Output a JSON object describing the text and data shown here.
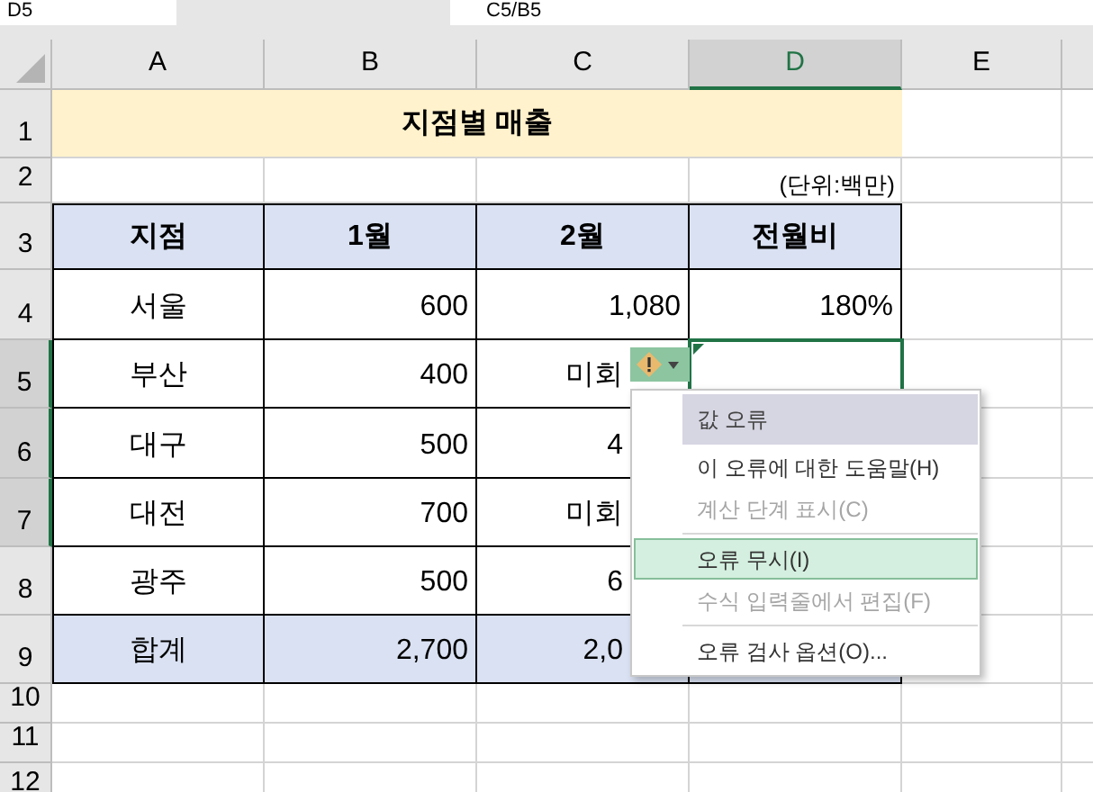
{
  "formula_bar": {
    "name_box": "D5",
    "formula": "C5/B5"
  },
  "column_headers": [
    {
      "label": "A",
      "selected": false
    },
    {
      "label": "B",
      "selected": false
    },
    {
      "label": "C",
      "selected": false
    },
    {
      "label": "D",
      "selected": true
    },
    {
      "label": "E",
      "selected": false
    }
  ],
  "rows": [
    {
      "number": "1",
      "selected": false,
      "kind": "title",
      "title": "지점별 매출"
    },
    {
      "number": "2",
      "selected": false,
      "kind": "note",
      "note": "(단위:백만)"
    },
    {
      "number": "3",
      "selected": false,
      "kind": "header",
      "cells": [
        "지점",
        "1월",
        "2월",
        "전월비"
      ]
    },
    {
      "number": "4",
      "selected": false,
      "kind": "data",
      "cells": [
        "서울",
        "600",
        "1,080",
        "180%"
      ]
    },
    {
      "number": "5",
      "selected": true,
      "kind": "data",
      "cells": [
        "부산",
        "400",
        "미회",
        ""
      ],
      "error_flag": true,
      "active": true
    },
    {
      "number": "6",
      "selected": true,
      "kind": "data",
      "cells": [
        "대구",
        "500",
        "4",
        ""
      ]
    },
    {
      "number": "7",
      "selected": true,
      "kind": "data",
      "cells": [
        "대전",
        "700",
        "미회",
        ""
      ]
    },
    {
      "number": "8",
      "selected": false,
      "kind": "data",
      "cells": [
        "광주",
        "500",
        "6",
        ""
      ]
    },
    {
      "number": "9",
      "selected": false,
      "kind": "total",
      "cells": [
        "합계",
        "2,700",
        "2,0",
        ""
      ]
    },
    {
      "number": "10",
      "selected": false,
      "kind": "empty"
    },
    {
      "number": "11",
      "selected": false,
      "kind": "empty"
    },
    {
      "number": "12",
      "selected": false,
      "kind": "empty"
    }
  ],
  "error_menu": [
    {
      "kind": "title",
      "label": "값 오류"
    },
    {
      "kind": "item",
      "label": "이 오류에 대한 도움말(H)",
      "disabled": false,
      "selected": false
    },
    {
      "kind": "item",
      "label": "계산 단계 표시(C)",
      "disabled": true,
      "selected": false
    },
    {
      "kind": "separator"
    },
    {
      "kind": "item",
      "label": "오류 무시(I)",
      "disabled": false,
      "selected": true
    },
    {
      "kind": "item",
      "label": "수식 입력줄에서 편집(F)",
      "disabled": true,
      "selected": false
    },
    {
      "kind": "separator"
    },
    {
      "kind": "item",
      "label": "오류 검사 옵션(O)...",
      "disabled": false,
      "selected": false
    }
  ]
}
